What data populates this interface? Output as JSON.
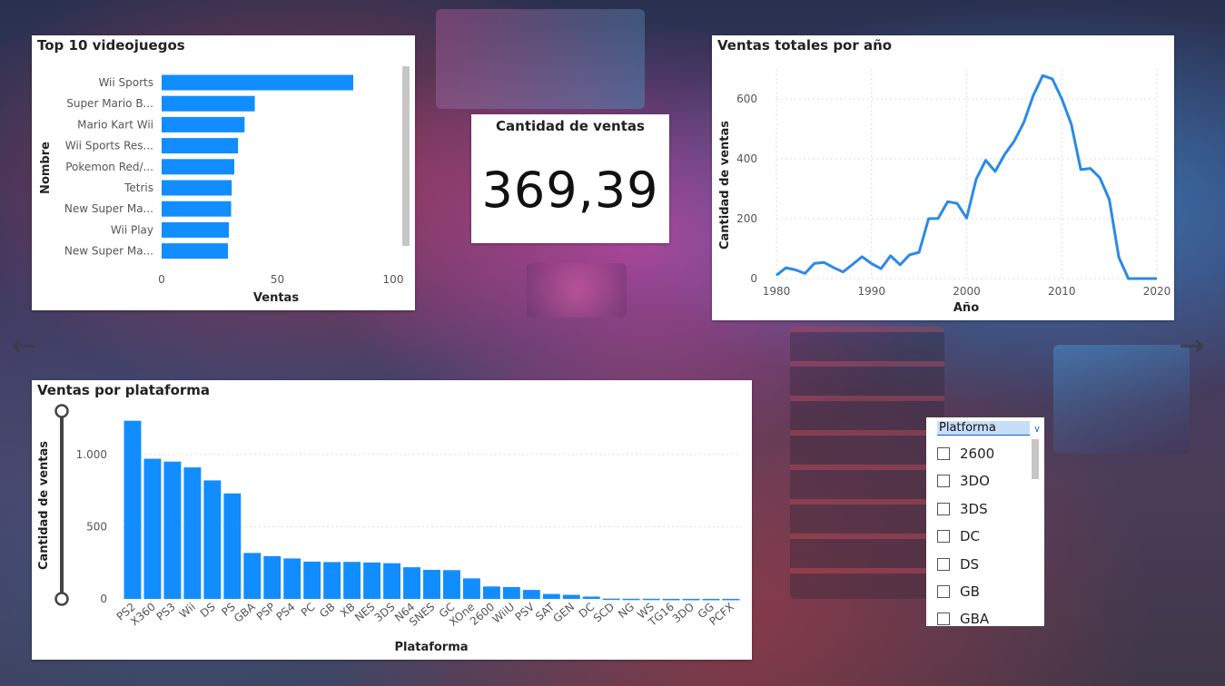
{
  "colors": {
    "accent": "#118dff",
    "line": "#2b8ae6"
  },
  "top10": {
    "title": "Top 10 videojuegos",
    "xlabel": "Ventas",
    "ylabel": "Nombre",
    "ticks": [
      "0",
      "50",
      "100"
    ]
  },
  "kpi": {
    "label": "Cantidad de ventas",
    "value": "369,39"
  },
  "yearly": {
    "title": "Ventas totales por año",
    "xlabel": "Año",
    "ylabel": "Cantidad de ventas",
    "yticks": [
      "0",
      "200",
      "400",
      "600"
    ],
    "xticks": [
      "1980",
      "1990",
      "2000",
      "2010",
      "2020"
    ]
  },
  "platform": {
    "title": "Ventas por plataforma",
    "xlabel": "Plataforma",
    "ylabel": "Cantidad de ventas",
    "yticks": [
      "0",
      "500",
      "1.000"
    ]
  },
  "slicer": {
    "title": "Platforma",
    "items": [
      "2600",
      "3DO",
      "3DS",
      "DC",
      "DS",
      "GB",
      "GBA"
    ]
  },
  "nav": {
    "prev": "←",
    "next": "→"
  },
  "chart_data": [
    {
      "type": "bar",
      "orientation": "horizontal",
      "title": "Top 10 videojuegos",
      "xlabel": "Ventas",
      "ylabel": "Nombre",
      "categories": [
        "Wii Sports",
        "Super Mario B...",
        "Mario Kart Wii",
        "Wii Sports Res...",
        "Pokemon Red/...",
        "Tetris",
        "New Super Ma...",
        "Wii Play",
        "New Super Ma..."
      ],
      "values": [
        82.74,
        40.24,
        35.82,
        33.0,
        31.37,
        30.26,
        30.01,
        29.02,
        28.62
      ],
      "xlim": [
        0,
        100
      ]
    },
    {
      "type": "line",
      "title": "Ventas totales por año",
      "xlabel": "Año",
      "ylabel": "Cantidad de ventas",
      "x": [
        1980,
        1981,
        1982,
        1983,
        1984,
        1985,
        1986,
        1987,
        1988,
        1989,
        1990,
        1991,
        1992,
        1993,
        1994,
        1995,
        1996,
        1997,
        1998,
        1999,
        2000,
        2001,
        2002,
        2003,
        2004,
        2005,
        2006,
        2007,
        2008,
        2009,
        2010,
        2011,
        2012,
        2013,
        2014,
        2015,
        2016,
        2017,
        2018,
        2019,
        2020
      ],
      "y": [
        11,
        36,
        29,
        17,
        51,
        54,
        37,
        22,
        47,
        73,
        50,
        33,
        76,
        46,
        79,
        88,
        200,
        201,
        257,
        251,
        202,
        332,
        395,
        358,
        415,
        459,
        521,
        611,
        678,
        667,
        600,
        516,
        364,
        368,
        337,
        264,
        71,
        0,
        0,
        0,
        0
      ],
      "xlim": [
        1980,
        2020
      ],
      "ylim": [
        0,
        700
      ]
    },
    {
      "type": "bar",
      "title": "Ventas por plataforma",
      "xlabel": "Plataforma",
      "ylabel": "Cantidad de ventas",
      "categories": [
        "PS2",
        "X360",
        "PS3",
        "Wii",
        "DS",
        "PS",
        "GBA",
        "PSP",
        "PS4",
        "PC",
        "GB",
        "XB",
        "NES",
        "3DS",
        "N64",
        "SNES",
        "GC",
        "XOne",
        "2600",
        "WiiU",
        "PSV",
        "SAT",
        "GEN",
        "DC",
        "SCD",
        "NG",
        "WS",
        "TG16",
        "3DO",
        "GG",
        "PCFX"
      ],
      "values": [
        1233,
        970,
        950,
        910,
        820,
        730,
        318,
        296,
        280,
        258,
        255,
        256,
        252,
        247,
        219,
        201,
        199,
        142,
        86,
        82,
        62,
        34,
        28,
        16,
        2,
        1,
        1,
        0.2,
        0.1,
        0.04,
        0.03
      ],
      "ylim": [
        0,
        1300
      ]
    }
  ]
}
